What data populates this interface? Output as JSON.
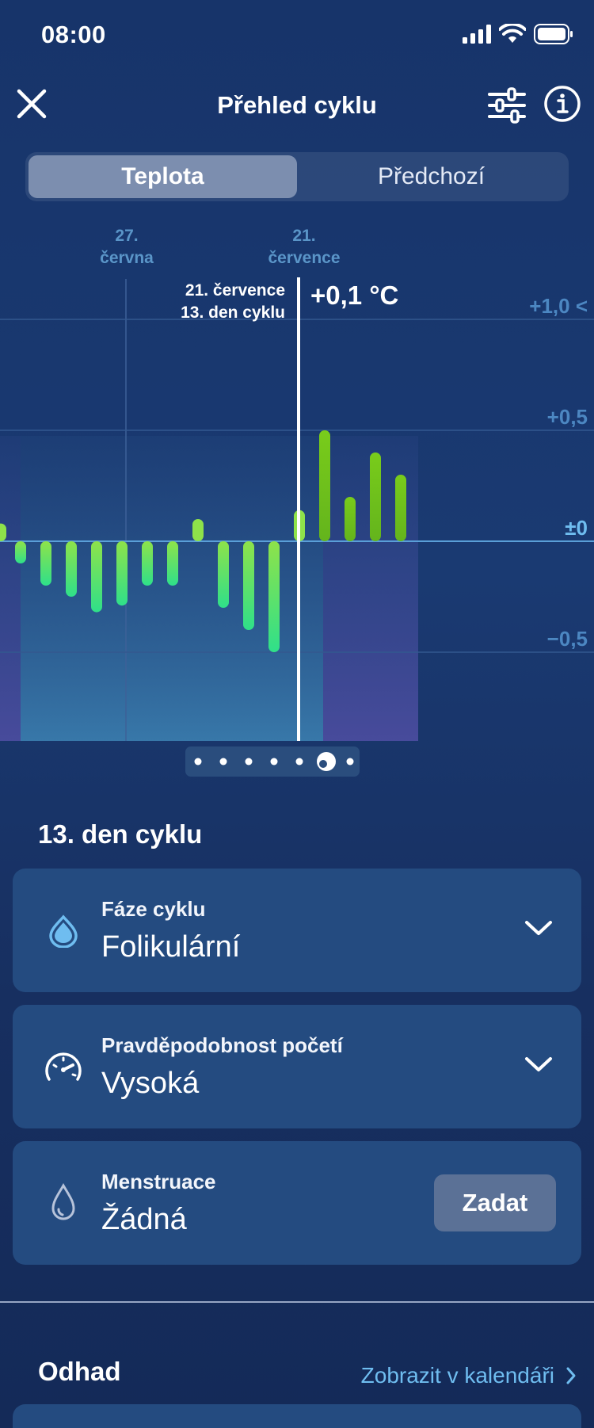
{
  "status_bar": {
    "time": "08:00"
  },
  "nav": {
    "title": "Přehled cyklu"
  },
  "segments": {
    "active": "Teplota",
    "inactive": "Předchozí"
  },
  "chart_header": {
    "date_a_line1": "27.",
    "date_a_line2": "června",
    "date_b_line1": "21.",
    "date_b_line2": "července"
  },
  "tooltip": {
    "date": "21. července",
    "day": "13. den cyklu",
    "value": "+0,1 °C"
  },
  "y_labels": [
    "+1,0 <",
    "+0,5",
    "±0",
    "−0,5"
  ],
  "chart_data": {
    "type": "bar",
    "x": [
      1,
      2,
      3,
      4,
      5,
      6,
      7,
      8,
      9,
      10,
      11,
      12,
      13,
      14,
      15,
      16
    ],
    "values": [
      -0.1,
      -0.2,
      -0.25,
      -0.32,
      -0.29,
      -0.2,
      -0.2,
      0.1,
      -0.3,
      -0.4,
      -0.5,
      0.14,
      0.5,
      0.2,
      0.4,
      0.3
    ],
    "series_colors": {
      "negative": "#4ee27c",
      "positive": "#7ed321"
    },
    "ylim": [
      -0.9,
      1.1
    ],
    "yticks": [
      1.0,
      0.5,
      0,
      -0.5
    ],
    "selected_index": 11,
    "grid": true
  },
  "pager": {
    "count": 7,
    "active": 5
  },
  "day_section": {
    "title": "13. den cyklu"
  },
  "cards": {
    "phase": {
      "label": "Fáze cyklu",
      "value": "Folikulární"
    },
    "probability": {
      "label": "Pravděpodobnost početí",
      "value": "Vysoká"
    },
    "menstruation": {
      "label": "Menstruace",
      "value": "Žádná",
      "button": "Zadat"
    }
  },
  "estimate": {
    "title": "Odhad",
    "link": "Zobrazit v kalendáři"
  },
  "colors": {
    "accent": "#6fbdf0",
    "card_bg": "#244b80",
    "button_bg": "#5b7196"
  }
}
